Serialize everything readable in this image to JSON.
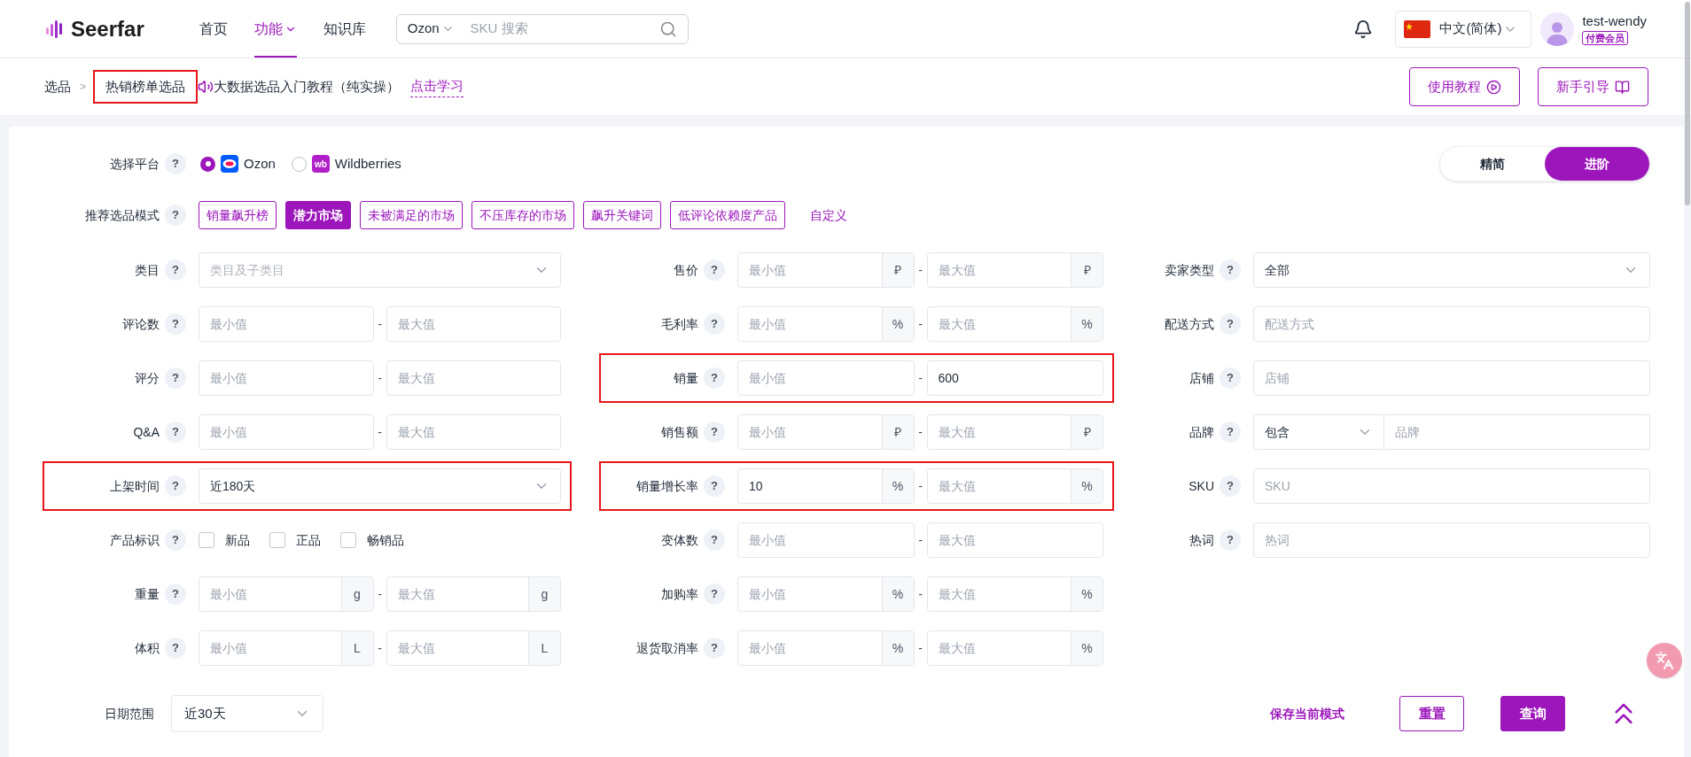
{
  "header": {
    "logo": "Seerfar",
    "nav": [
      {
        "label": "首页",
        "selected": false,
        "dropdown": false
      },
      {
        "label": "功能",
        "selected": true,
        "dropdown": true
      },
      {
        "label": "知识库",
        "selected": false,
        "dropdown": false
      }
    ],
    "search": {
      "platform": "Ozon",
      "placeholder": "SKU 搜索"
    },
    "language": "中文(简体)",
    "user": {
      "name": "test-wendy",
      "badge": "付费会员"
    }
  },
  "breadcrumb": {
    "items": [
      {
        "label": "选品",
        "highlighted": false
      },
      {
        "label": "热销榜单选品",
        "highlighted": true
      }
    ],
    "separator": ">",
    "notice": "大数据选品入门教程（纯实操）",
    "notice_link": "点击学习"
  },
  "guide_buttons": [
    {
      "label": "使用教程",
      "kind": "video"
    },
    {
      "label": "新手引导",
      "kind": "guide"
    }
  ],
  "view_toggle": [
    {
      "label": "精简",
      "selected": false
    },
    {
      "label": "进阶",
      "selected": true
    }
  ],
  "platform": {
    "label": "选择平台",
    "help": "?",
    "options": [
      {
        "name": "Ozon",
        "kind": "ozon",
        "selected": true
      },
      {
        "name": "Wildberries",
        "kind": "wb",
        "logo_text": "wb",
        "selected": false
      }
    ]
  },
  "modes": {
    "label": "推荐选品模式",
    "help": "?",
    "items": [
      {
        "label": "销量飙升榜",
        "kind": "chip",
        "selected": false
      },
      {
        "label": "潜力市场",
        "kind": "chip",
        "selected": true
      },
      {
        "label": "未被满足的市场",
        "kind": "chip",
        "selected": false
      },
      {
        "label": "不压库存的市场",
        "kind": "chip",
        "selected": false
      },
      {
        "label": "飙升关键词",
        "kind": "chip",
        "selected": false
      },
      {
        "label": "低评论依赖度产品",
        "kind": "chip",
        "selected": false
      },
      {
        "label": "自定义",
        "kind": "link",
        "selected": false
      }
    ]
  },
  "filter_columns": [
    [
      {
        "label": "类目",
        "help": "?",
        "kind": "select",
        "highlighted": false,
        "placeholder": "类目及子类目"
      },
      {
        "label": "评论数",
        "help": "?",
        "kind": "range",
        "highlighted": false,
        "separator": "-",
        "min": {
          "placeholder": "最小值"
        },
        "max": {
          "placeholder": "最大值"
        }
      },
      {
        "label": "评分",
        "help": "?",
        "kind": "range",
        "highlighted": false,
        "separator": "-",
        "min": {
          "placeholder": "最小值"
        },
        "max": {
          "placeholder": "最大值"
        }
      },
      {
        "label": "Q&A",
        "help": "?",
        "kind": "range",
        "highlighted": false,
        "separator": "-",
        "min": {
          "placeholder": "最小值"
        },
        "max": {
          "placeholder": "最大值"
        }
      },
      {
        "label": "上架时间",
        "help": "?",
        "kind": "select",
        "highlighted": true,
        "value": "近180天"
      },
      {
        "label": "产品标识",
        "help": "?",
        "kind": "checkboxes",
        "highlighted": false,
        "options": [
          {
            "label": "新品",
            "checked": false
          },
          {
            "label": "正品",
            "checked": false
          },
          {
            "label": "畅销品",
            "checked": false
          }
        ]
      },
      {
        "label": "重量",
        "help": "?",
        "kind": "range",
        "highlighted": false,
        "separator": "-",
        "min": {
          "placeholder": "最小值",
          "unit": "g"
        },
        "max": {
          "placeholder": "最大值",
          "unit": "g"
        }
      },
      {
        "label": "体积",
        "help": "?",
        "kind": "range",
        "highlighted": false,
        "separator": "-",
        "min": {
          "placeholder": "最小值",
          "unit": "L"
        },
        "max": {
          "placeholder": "最大值",
          "unit": "L"
        }
      }
    ],
    [
      {
        "label": "售价",
        "help": "?",
        "kind": "range",
        "highlighted": false,
        "separator": "-",
        "min": {
          "placeholder": "最小值",
          "unit": "₽"
        },
        "max": {
          "placeholder": "最大值",
          "unit": "₽"
        }
      },
      {
        "label": "毛利率",
        "help": "?",
        "kind": "range",
        "highlighted": false,
        "separator": "-",
        "min": {
          "placeholder": "最小值",
          "unit": "%"
        },
        "max": {
          "placeholder": "最大值",
          "unit": "%"
        }
      },
      {
        "label": "销量",
        "help": "?",
        "kind": "range",
        "highlighted": true,
        "separator": "-",
        "min": {
          "placeholder": "最小值"
        },
        "max": {
          "value": "600"
        }
      },
      {
        "label": "销售额",
        "help": "?",
        "kind": "range",
        "highlighted": false,
        "separator": "-",
        "min": {
          "placeholder": "最小值",
          "unit": "₽"
        },
        "max": {
          "placeholder": "最大值",
          "unit": "₽"
        }
      },
      {
        "label": "销量增长率",
        "help": "?",
        "kind": "range",
        "highlighted": true,
        "separator": "-",
        "min": {
          "value": "10",
          "unit": "%"
        },
        "max": {
          "placeholder": "最大值",
          "unit": "%"
        }
      },
      {
        "label": "变体数",
        "help": "?",
        "kind": "range",
        "highlighted": false,
        "separator": "-",
        "min": {
          "placeholder": "最小值"
        },
        "max": {
          "placeholder": "最大值"
        }
      },
      {
        "label": "加购率",
        "help": "?",
        "kind": "range",
        "highlighted": false,
        "separator": "-",
        "min": {
          "placeholder": "最小值",
          "unit": "%"
        },
        "max": {
          "placeholder": "最大值",
          "unit": "%"
        }
      },
      {
        "label": "退货取消率",
        "help": "?",
        "kind": "range",
        "highlighted": false,
        "separator": "-",
        "min": {
          "placeholder": "最小值",
          "unit": "%"
        },
        "max": {
          "placeholder": "最大值",
          "unit": "%"
        }
      }
    ],
    [
      {
        "label": "卖家类型",
        "help": "?",
        "kind": "select",
        "highlighted": false,
        "value": "全部"
      },
      {
        "label": "配送方式",
        "help": "?",
        "kind": "text",
        "highlighted": false,
        "placeholder": "配送方式"
      },
      {
        "label": "店铺",
        "help": "?",
        "kind": "text",
        "highlighted": false,
        "placeholder": "店铺"
      },
      {
        "label": "品牌",
        "help": "?",
        "kind": "brand",
        "highlighted": false,
        "value": "包含",
        "placeholder": "品牌"
      },
      {
        "label": "SKU",
        "help": "?",
        "kind": "text",
        "highlighted": false,
        "placeholder": "SKU"
      },
      {
        "label": "热词",
        "help": "?",
        "kind": "text",
        "highlighted": false,
        "placeholder": "热词"
      }
    ]
  ],
  "footer": {
    "date_range": {
      "label": "日期范围",
      "value": "近30天"
    },
    "save_link": "保存当前模式",
    "buttons": [
      {
        "label": "重置",
        "kind": "secondary"
      },
      {
        "label": "查询",
        "kind": "primary"
      }
    ]
  }
}
